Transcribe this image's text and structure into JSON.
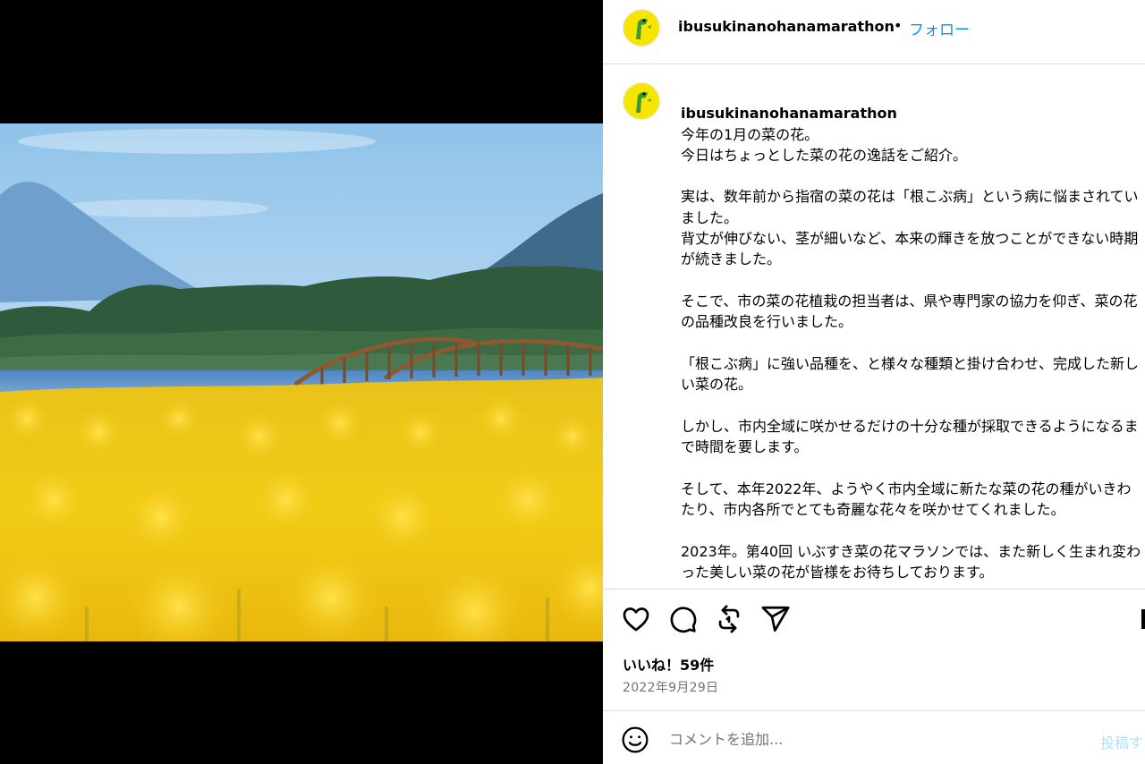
{
  "post": {
    "username": "ibusukinanohanamarathon",
    "separator": "•",
    "follow_label": "フォロー"
  },
  "caption": {
    "username": "ibusukinanohanamarathon",
    "first_line": "今年の1月の菜の花。",
    "paragraphs": [
      "今日はちょっとした菜の花の逸話をご紹介。",
      "実は、数年前から指宿の菜の花は「根こぶ病」という病に悩まされていました。\n背丈が伸びない、茎が細いなど、本来の輝きを放つことができない時期が続きました。",
      "そこで、市の菜の花植栽の担当者は、県や専門家の協力を仰ぎ、菜の花の品種改良を行いました。",
      "「根こぶ病」に強い品種を、と様々な種類と掛け合わせ、完成した新しい菜の花。",
      "しかし、市内全域に咲かせるだけの十分な種が採取できるようになるまで時間を要します。",
      "そして、本年2022年、ようやく市内全域に新たな菜の花の種がいきわたり、市内各所でとても奇麗な花々を咲かせてくれました。",
      "2023年。第40回 いぶすき菜の花マラソンでは、また新しく生まれ変わった美しい菜の花が皆様をお待ちしております。"
    ]
  },
  "actions": {
    "icons": [
      "heart-icon",
      "comment-icon",
      "repost-icon",
      "share-icon",
      "bookmark-icon"
    ]
  },
  "likes_label": "いいね！59件",
  "date_label": "2022年9月29日",
  "comment": {
    "placeholder": "コメントを追加...",
    "post_label": "投稿する"
  },
  "colors": {
    "link_blue": "#0095f6",
    "post_disabled": "#b2dffc",
    "muted": "#737373",
    "avatar_yellow": "#f5e500",
    "avatar_green": "#3a9a3a"
  }
}
